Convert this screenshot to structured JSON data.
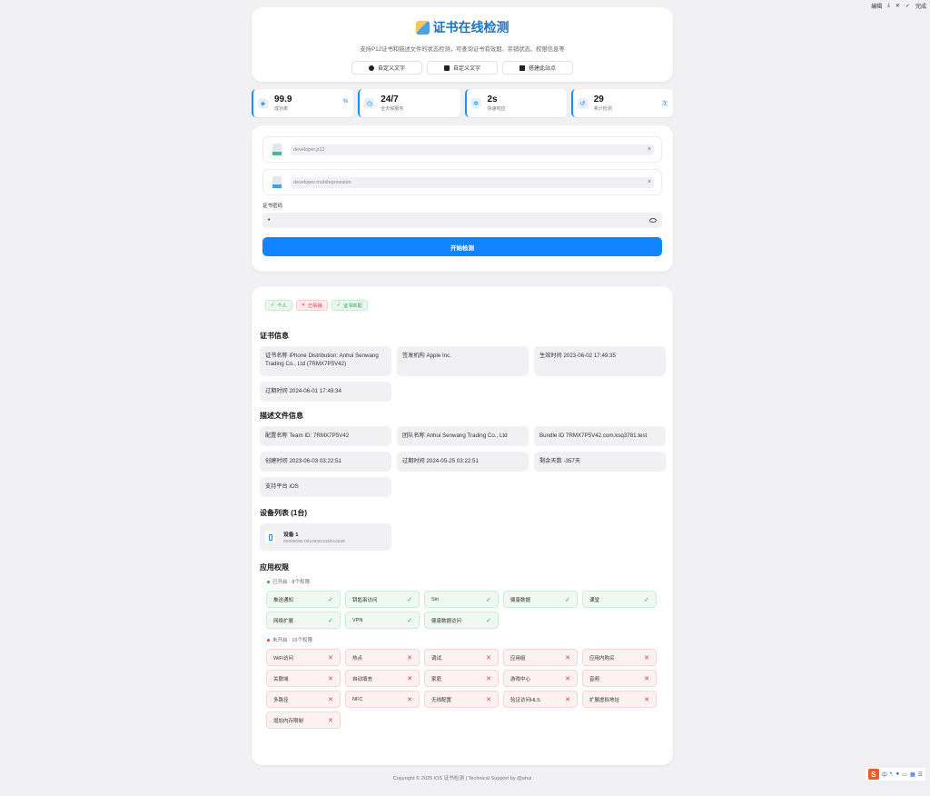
{
  "topbar": {
    "items": [
      "编辑",
      "完成"
    ]
  },
  "header": {
    "title": "证书在线检测",
    "subtitle": "支持P12证书和描述文件的状态检测，可查询证书有效期、吊销状态、权限信息等",
    "buttons": [
      {
        "label": "自定义文字",
        "icon": "info-icon"
      },
      {
        "label": "自定义文字",
        "icon": "chat-icon"
      },
      {
        "label": "搭建此站点",
        "icon": "flag-icon"
      }
    ]
  },
  "stats": [
    {
      "value": "99.9",
      "label": "成功率",
      "unit": "%",
      "icon": "shield-icon"
    },
    {
      "value": "24/7",
      "label": "全天候服务",
      "unit": "",
      "icon": "clock-icon"
    },
    {
      "value": "2s",
      "label": "快速响应",
      "unit": "",
      "icon": "gear-icon"
    },
    {
      "value": "29",
      "label": "累计检测",
      "unit": "次",
      "icon": "history-icon"
    }
  ],
  "form": {
    "p12_file": "developer.p12",
    "prov_file": "developer.mobileprovision",
    "password_label": "证书密码",
    "password_value": "•",
    "submit_label": "开始检测"
  },
  "result": {
    "badges": [
      {
        "label": "个人",
        "mark": "✓",
        "status": "ok"
      },
      {
        "label": "已吊销",
        "mark": "✕",
        "status": "bad"
      },
      {
        "label": "证书匹配",
        "mark": "✓",
        "status": "ok"
      }
    ],
    "cert_section_title": "证书信息",
    "cert_info": [
      "证书名称 iPhone Distribution: Anhui Senwang Trading Co., Ltd (7RMX7P5V42)",
      "签发机构 Apple Inc.",
      "生效时间 2023-06-02 17:49:35",
      "过期时间 2024-06-01 17:49:34"
    ],
    "profile_section_title": "描述文件信息",
    "profile_info": [
      "配置名称 Team ID: 7RMX7P5V42",
      "团队名称 Anhui Senwang Trading Co., Ltd",
      "Bundle ID 7RMX7P5V42.com.ksq3781.test",
      "创建时间 2023-06-03 03:22:51",
      "过期时间 2024-05-25 03:22:51",
      "剩余天数 -357天",
      "支持平台 iOS"
    ],
    "device_section_title": "设备列表 (1台)",
    "device": {
      "name": "设备 1",
      "id": "00008030-001064D434DA402E"
    },
    "perm_section_title": "应用权限",
    "enabled_header": "已开启 · 8个权限",
    "enabled": [
      "推送通知",
      "钥匙串访问",
      "Siri",
      "健康数据",
      "课堂",
      "网络扩展",
      "VPN",
      "健康数据访问"
    ],
    "disabled_header": "未开启 · 16个权限",
    "disabled": [
      "WiFi访问",
      "热点",
      "调试",
      "应用组",
      "应用内购买",
      "关联域",
      "自动填充",
      "家庭",
      "游戏中心",
      "音频",
      "多路径",
      "NFC",
      "无线配置",
      "验证访问HLS",
      "扩展虚拟地址",
      "增加内存限制"
    ],
    "ok_mark": "✓",
    "bad_mark": "✕"
  },
  "footer": "Copyright © 2025 iOS 证书检测 | Technical Support by @ahui",
  "ime": {
    "logo": "S",
    "lang": "中"
  },
  "colors": {
    "accent": "#1184ff",
    "title": "#1773c9",
    "ok": "#2fa25a",
    "bad": "#d94040"
  }
}
